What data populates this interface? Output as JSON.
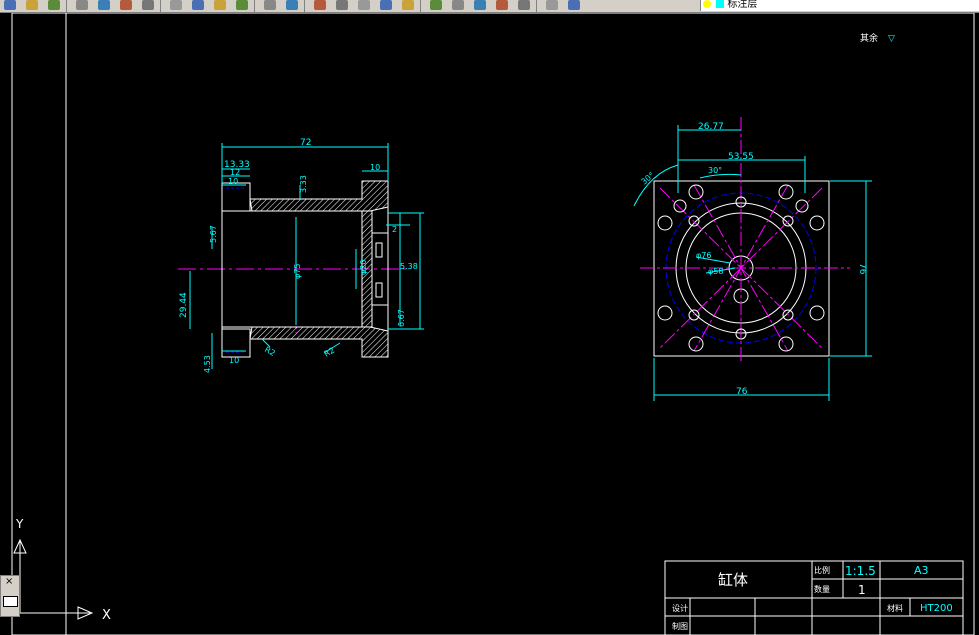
{
  "toolbar": {
    "icons": [
      "new-icon",
      "open-icon",
      "save-icon",
      "print-icon",
      "preview-icon",
      "publish-icon",
      "plot-icon",
      "cut-icon",
      "copy-icon",
      "paste-icon",
      "matchprop-icon",
      "undo-icon",
      "redo-icon",
      "pan-icon",
      "zoom-realtime-icon",
      "zoom-window-icon",
      "zoom-previous-icon",
      "properties-icon",
      "designcenter-icon",
      "toolpalette-icon",
      "sheetset-icon",
      "markup-icon",
      "calculator-icon",
      "help-icon",
      "layer-manager-icon"
    ],
    "layer_name": "标注层",
    "colors": {
      "bg": "#d4d0c8",
      "lightbulb": "#ffff00",
      "layer_swatch": "#00ffff"
    }
  },
  "drawing": {
    "corner_note": "其余",
    "corner_symbol": "▽",
    "front_view": {
      "dims": {
        "overall_length": "72",
        "d1333": "13.33",
        "d12": "12",
        "d10a": "10",
        "d10b": "10",
        "d10right": "10",
        "d333": "3.33",
        "d567": "5.67",
        "d2944": "29.44",
        "d453": "4.53",
        "d10bottom": "10",
        "phi75": "φ75",
        "phi20": "φ20",
        "d538": "5.38",
        "d667": "6.67",
        "d2": "2",
        "r2a": "R2",
        "r2b": "R2"
      }
    },
    "side_view": {
      "dims": {
        "d2677": "26.77",
        "d5355": "53.55",
        "ang30a": "30°",
        "ang30b": "30°",
        "phi76": "φ76",
        "phi58": "φ58",
        "w76": "76",
        "h76": "76"
      }
    },
    "title_block": {
      "part_name": "缸体",
      "scale_label": "比例",
      "scale_value": "1:1.5",
      "qty_label": "数量",
      "qty_value": "1",
      "paper": "A3",
      "material_label": "材料",
      "material_value": "HT200",
      "design_label": "设计",
      "check_label": "制图"
    },
    "ucs": {
      "y": "Y",
      "x": "X"
    },
    "colors": {
      "outline": "#ffffff",
      "dimension": "#00ffff",
      "center": "#ff00ff",
      "hidden": "#0000ff",
      "hatch": "#ffffff",
      "red": "#ff0000"
    }
  }
}
